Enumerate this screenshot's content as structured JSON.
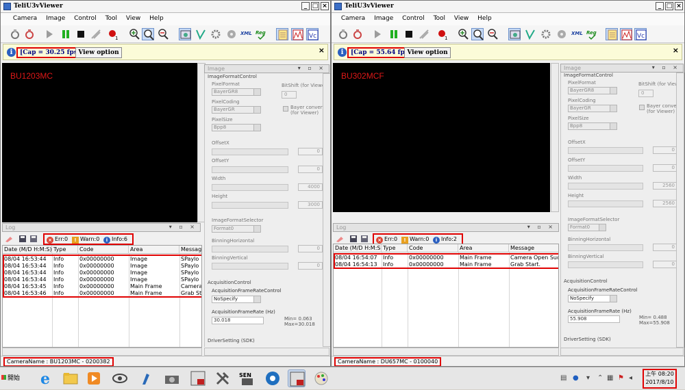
{
  "left_window": {
    "title": "TeliU3vViewer",
    "window_buttons": [
      "_",
      "□",
      "×"
    ],
    "menu": [
      "Camera",
      "Image",
      "Control",
      "Tool",
      "View",
      "Help"
    ],
    "cap_text": "[Cap = 30.25 fps]",
    "view_option": "View option",
    "info_close": "×",
    "camera_overlay": "BU1203MC",
    "image_panel_title": "Image",
    "panel_controls": "▾ ▫ ×",
    "log_panel_title": "Log",
    "filter_err": "Err:0",
    "filter_warn": "Warn:0",
    "filter_info": "Info:6",
    "log_columns": [
      "Date (M/D H:M:S)",
      "Type",
      "Code",
      "Area",
      "Message"
    ],
    "log_rows": [
      [
        "08/04 16:53:44",
        "Info",
        "0x00000000",
        "Image",
        "SPaylo"
      ],
      [
        "08/04 16:53:44",
        "Info",
        "0x00000000",
        "Image",
        "SPaylo"
      ],
      [
        "08/04 16:53:44",
        "Info",
        "0x00000000",
        "Image",
        "SPaylo"
      ],
      [
        "08/04 16:53:44",
        "Info",
        "0x00000000",
        "Image",
        "SPaylo"
      ],
      [
        "08/04 16:53:45",
        "Info",
        "0x00000000",
        "Main Frame",
        "Camera"
      ],
      [
        "08/04 16:53:46",
        "Info",
        "0x00000000",
        "Main Frame",
        "Grab St"
      ]
    ],
    "status_camera_name": "CameraName : BU1203MC - 0200382",
    "props": {
      "group_format": "ImageFormatControl",
      "pixel_format_label": "PixelFormat",
      "pixel_format": "BayerGR8",
      "bitshift_label": "BitShift (for Viewer)",
      "bitshift_value": "0",
      "pixel_coding_label": "PixelCoding",
      "pixel_coding": "BayerGR",
      "bayer_convert": "Bayer convert (for Viewer)",
      "pixel_size_label": "PixelSize",
      "pixel_size": "Bpp8",
      "offset_x_label": "OffsetX",
      "offset_x": "0",
      "offset_y_label": "OffsetY",
      "offset_y": "0",
      "width_label": "Width",
      "width": "4000",
      "height_label": "Height",
      "height": "3000",
      "selector_label": "ImageFormatSelector",
      "selector": "Format0",
      "binning_h_label": "BinningHorizontal",
      "binning_h": "0",
      "binning_v_label": "BinningVertical",
      "binning_v": "0",
      "group_acq": "AcquisitionControl",
      "afr_control_label": "AcquisitionFrameRateControl",
      "afr_control": "NoSpecify",
      "afr_label": "AcquisitionFrameRate (Hz)",
      "afr": "30.018",
      "afr_range": "Min= 0.063\nMax=30.018",
      "group_driver": "DriverSetting (SDK)"
    }
  },
  "right_window": {
    "title": "TeliU3vViewer",
    "window_buttons": [
      "_",
      "□",
      "×"
    ],
    "menu": [
      "Camera",
      "Image",
      "Control",
      "Tool",
      "View",
      "Help"
    ],
    "cap_text": "[Cap = 55.64 fps]",
    "view_option": "View option",
    "info_close": "×",
    "camera_overlay": "BU302MCF",
    "image_panel_title": "Image",
    "panel_controls": "▾ ▫ ×",
    "log_panel_title": "Log",
    "filter_err": "Err:0",
    "filter_warn": "Warn:0",
    "filter_info": "Info:2",
    "log_columns": [
      "Date (M/D H:M:S)",
      "Type",
      "Code",
      "Area",
      "Message"
    ],
    "log_rows": [
      [
        "08/04 16:54:07",
        "Info",
        "0x00000000",
        "Main Frame",
        "Camera Open Succ"
      ],
      [
        "08/04 16:54:13",
        "Info",
        "0x00000000",
        "Main Frame",
        "Grab Start."
      ]
    ],
    "status_camera_name": "CameraName : DU657MC - 0100040",
    "props": {
      "group_format": "ImageFormatControl",
      "pixel_format_label": "PixelFormat",
      "pixel_format": "BayerGR8",
      "bitshift_label": "BitShift (for Viewer)",
      "bitshift_value": "0",
      "pixel_coding_label": "PixelCoding",
      "pixel_coding": "BayerGR",
      "bayer_convert": "Bayer convert (for Viewer)",
      "pixel_size_label": "PixelSize",
      "pixel_size": "Bpp8",
      "offset_x_label": "OffsetX",
      "offset_x": "0",
      "offset_y_label": "OffsetY",
      "offset_y": "0",
      "width_label": "Width",
      "width": "2560",
      "height_label": "Height",
      "height": "2560",
      "selector_label": "ImageFormatSelector",
      "selector": "Format0",
      "binning_h_label": "BinningHorizontal",
      "binning_h": "0",
      "binning_v_label": "BinningVertical",
      "binning_v": "0",
      "group_acq": "AcquisitionControl",
      "afr_control_label": "AcquisitionFrameRateControl",
      "afr_control": "NoSpecify",
      "afr_label": "AcquisitionFrameRate (Hz)",
      "afr": "55.908",
      "afr_range": "Min= 0.488\nMax=55.908",
      "group_driver": "DriverSetting (SDK)"
    }
  },
  "taskbar": {
    "start_label": "開始",
    "clock_time": "上午 08:20",
    "clock_date": "2017/8/10"
  },
  "colors": {
    "highlight": "#e00000",
    "camera_text": "#e01818",
    "info_blue": "#2b5fc0"
  }
}
